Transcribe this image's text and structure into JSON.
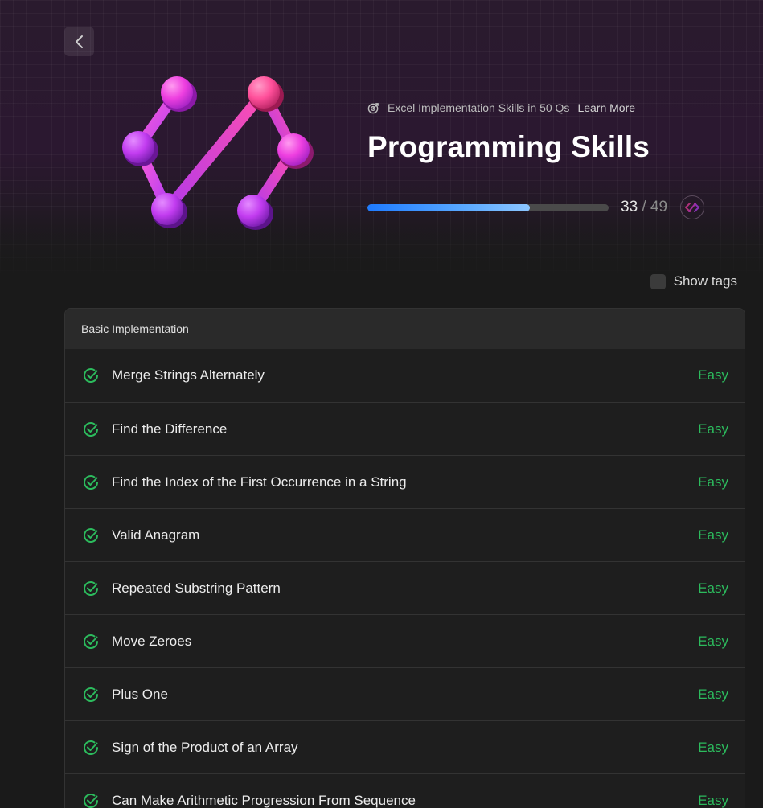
{
  "header": {
    "back_label": "Back",
    "subtitle": "Excel Implementation Skills in 50 Qs",
    "learn_more": "Learn More",
    "title": "Programming Skills",
    "progress": {
      "completed": "33",
      "separator": "/",
      "total": "49",
      "fraction": 0.673
    }
  },
  "controls": {
    "show_tags": "Show tags"
  },
  "section": {
    "title": "Basic Implementation",
    "items": [
      {
        "name": "Merge Strings Alternately",
        "difficulty": "Easy"
      },
      {
        "name": "Find the Difference",
        "difficulty": "Easy"
      },
      {
        "name": "Find the Index of the First Occurrence in a String",
        "difficulty": "Easy"
      },
      {
        "name": "Valid Anagram",
        "difficulty": "Easy"
      },
      {
        "name": "Repeated Substring Pattern",
        "difficulty": "Easy"
      },
      {
        "name": "Move Zeroes",
        "difficulty": "Easy"
      },
      {
        "name": "Plus One",
        "difficulty": "Easy"
      },
      {
        "name": "Sign of the Product of an Array",
        "difficulty": "Easy"
      },
      {
        "name": "Can Make Arithmetic Progression From Sequence",
        "difficulty": "Easy"
      }
    ]
  },
  "icons": {
    "back": "chevron-left-icon",
    "target": "target-icon",
    "solved": "check-circle-icon",
    "badge": "code-badge-icon"
  },
  "colors": {
    "accent_blue": "#1e7bff",
    "easy_green": "#2cbb5d",
    "logo_pink": "#ff4fc8",
    "logo_purple": "#c03cff"
  }
}
